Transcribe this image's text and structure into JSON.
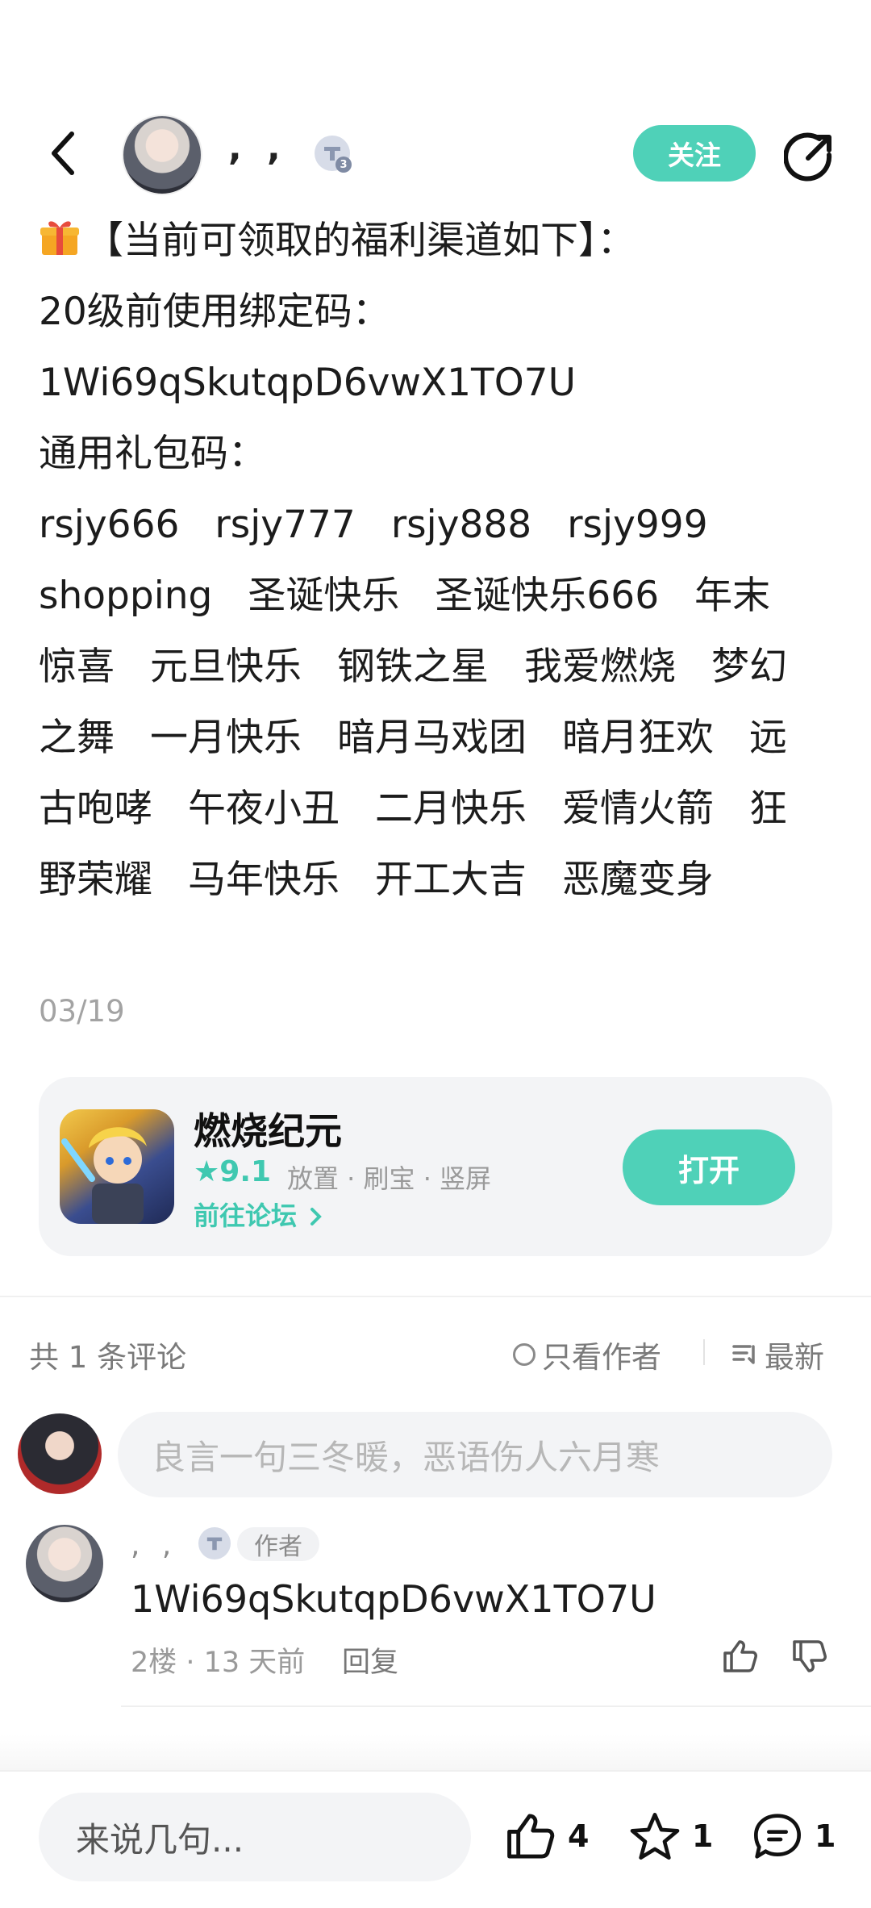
{
  "header": {
    "username": ", ,",
    "level": "3",
    "follow_label": "关注"
  },
  "post": {
    "title_line": "【当前可领取的福利渠道如下】：",
    "bind_label": "20级前使用绑定码：",
    "bind_code": "1Wi69qSkutqpD6vwX1TO7U",
    "codes_label": "通用礼包码：",
    "codes_lines": [
      [
        "rsjy666",
        "rsjy777",
        "rsjy888",
        "rsjy999"
      ],
      [
        "shopping",
        "圣诞快乐",
        "圣诞快乐666",
        "年末"
      ],
      [
        "惊喜",
        "元旦快乐",
        "钢铁之星",
        "我爱燃烧",
        "梦幻"
      ],
      [
        "之舞",
        "一月快乐",
        "暗月马戏团",
        "暗月狂欢",
        "远"
      ],
      [
        "古咆哮",
        "午夜小丑",
        "二月快乐",
        "爱情火箭",
        "狂"
      ],
      [
        "野荣耀",
        "马年快乐",
        "开工大吉",
        "恶魔变身"
      ]
    ],
    "date": "03/19"
  },
  "game": {
    "name": "燃烧纪元",
    "rating": "9.1",
    "tags": "放置 · 刷宝 · 竖屏",
    "forum_link": "前往论坛",
    "open_label": "打开"
  },
  "comments": {
    "count_label": "共 1 条评论",
    "only_author": "只看作者",
    "sort_label": "最新",
    "input_placeholder": "良言一句三冬暖，恶语伤人六月寒",
    "items": [
      {
        "name": ", ,",
        "level": "3",
        "tag": "作者",
        "text": "1Wi69qSkutqpD6vwX1TO7U",
        "meta": "2楼 · 13 天前",
        "reply": "回复"
      }
    ]
  },
  "bottom": {
    "input_placeholder": "来说几句...",
    "likes": "4",
    "favorites": "1",
    "comments": "1"
  },
  "colors": {
    "accent": "#4fd1b8",
    "accent_text": "#3fc8b0"
  }
}
